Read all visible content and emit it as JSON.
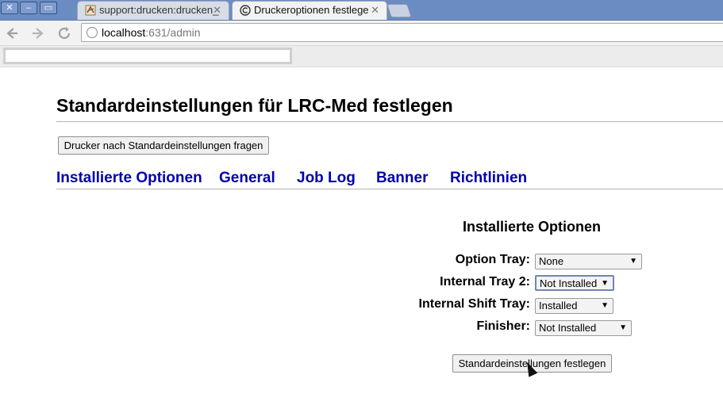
{
  "browser": {
    "window_controls": {
      "close": "✕",
      "minimize": "–",
      "restore": "▭"
    },
    "tabs": [
      {
        "label": "support:drucken:drucken_",
        "close": "✕",
        "active": false,
        "icon": "doc-favicon-icon"
      },
      {
        "label": "Druckeroptionen festlege",
        "close": "✕",
        "active": true,
        "icon": "cups-favicon-icon"
      }
    ],
    "url_host": "localhost",
    "url_rest": ":631/admin"
  },
  "page": {
    "title": "Standardeinstellungen für LRC-Med festlegen",
    "query_button": "Drucker nach Standardeinstellungen fragen",
    "nav": [
      "Installierte Optionen",
      "General",
      "Job Log",
      "Banner",
      "Richtlinien"
    ],
    "section_title": "Installierte Optionen",
    "options": [
      {
        "label": "Option Tray:",
        "value": "None"
      },
      {
        "label": "Internal Tray 2:",
        "value": "Not Installed"
      },
      {
        "label": "Internal Shift Tray:",
        "value": "Installed"
      },
      {
        "label": "Finisher:",
        "value": "Not Installed"
      }
    ],
    "submit_button": "Standardeinstellungen festlegen"
  },
  "colors": {
    "link": "#0000b0",
    "tabbar": "#6a8cc2"
  }
}
